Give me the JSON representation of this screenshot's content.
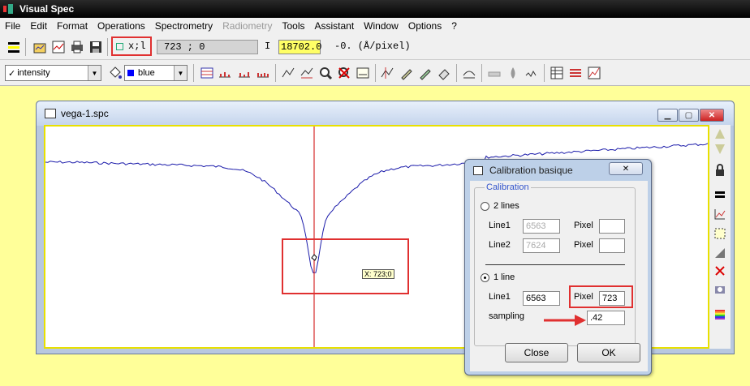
{
  "app": {
    "title": "Visual Spec"
  },
  "menu": [
    "File",
    "Edit",
    "Format",
    "Operations",
    "Spectrometry",
    "Radiometry",
    "Tools",
    "Assistant",
    "Window",
    "Options",
    "?"
  ],
  "toolbar": {
    "xl_label": "x;l",
    "coord_value": "723 ; 0",
    "i_label": "I",
    "intensity_value": "18702.0",
    "dispersion_text": "-0. (Å/pixel)",
    "display_select": "intensity",
    "display_check": "✓",
    "color_select": "blue",
    "color_value": "#0000ff"
  },
  "spectrum_window": {
    "title": "vega-1.spc",
    "cursor_label": "X: 723;0",
    "spectrum_color": "#1a1aaa",
    "cursor_color": "#cc0000"
  },
  "dialog": {
    "title": "Calibration basique",
    "close_label": "✕",
    "group_label": "Calibration",
    "option_2lines": "2 lines",
    "line1_label": "Line1",
    "line2_label": "Line2",
    "pixel_label": "Pixel",
    "line1_2l_value": "6563",
    "line2_2l_value": "7624",
    "option_1line": "1 line",
    "line1_1l_value": "6563",
    "pixel_1l_value": "723",
    "sampling_label": "sampling",
    "sampling_value": ".42",
    "close_button": "Close",
    "ok_button": "OK"
  },
  "colors": {
    "highlight": "#e03030",
    "background": "#ffff99",
    "arrow": "#e03030"
  }
}
